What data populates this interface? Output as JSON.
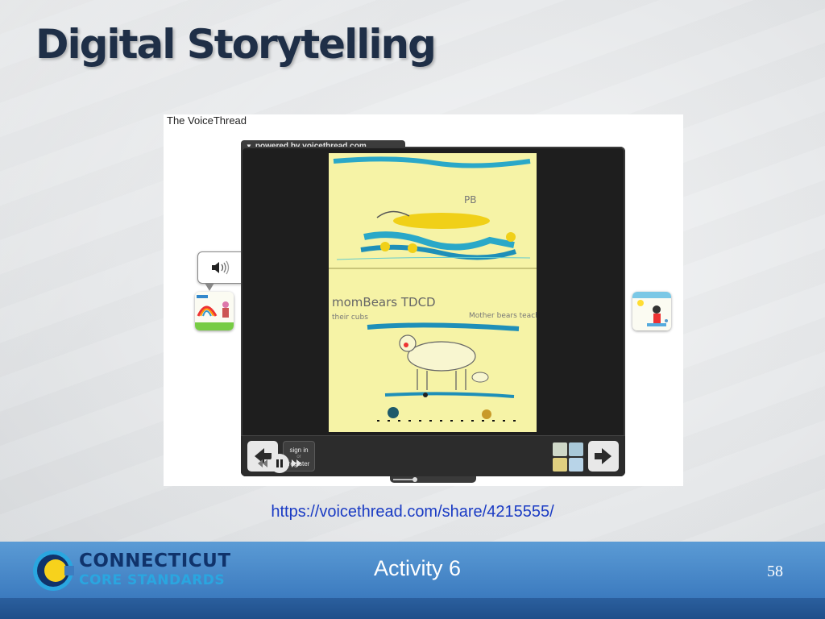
{
  "slide": {
    "title": "Digital Storytelling"
  },
  "embed": {
    "title": "The VoiceThread",
    "powered_by": "powered by voicethread.com",
    "sign_in": {
      "line1": "sign in",
      "line2": "or",
      "line3": "register"
    },
    "drawing_text": {
      "top_label": "PB",
      "caption_left": "momBears TDCD",
      "caption_left_2": "their cubs",
      "caption_right": "Mother bears teach"
    },
    "playback": {
      "state": "playing"
    }
  },
  "link": {
    "url": "https://voicethread.com/share/4215555/"
  },
  "footer": {
    "logo_line1": "CONNECTICUT",
    "logo_line2": "CORE STANDARDS",
    "label": "Activity 6",
    "page_number": "58"
  },
  "colors": {
    "title": "#1f2f47",
    "link": "#1a3bc4",
    "footer": "#3d7cc0",
    "logo_dark": "#10336b",
    "logo_light": "#2aa6e0",
    "logo_yellow": "#f7d21c"
  },
  "icons": {
    "prev": "arrow-left-icon",
    "next": "arrow-right-icon",
    "pause": "pause-icon",
    "speaker": "speaker-icon",
    "close": "close-icon"
  }
}
